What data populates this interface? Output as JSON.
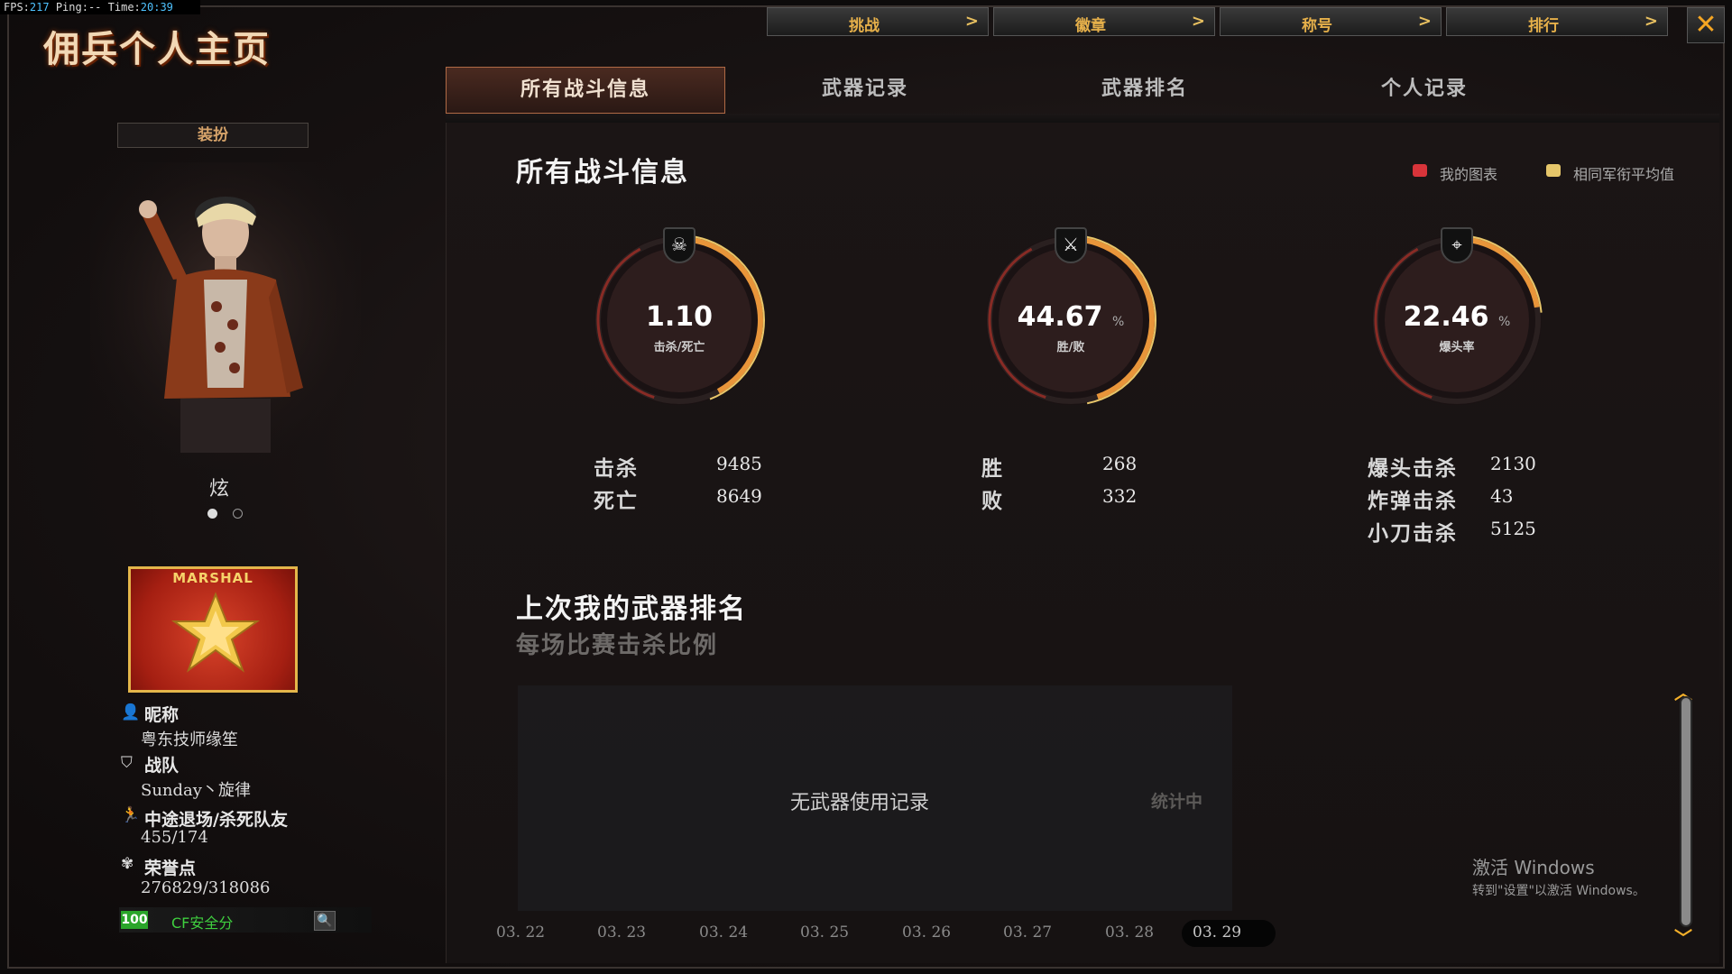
{
  "overlay": {
    "fps_label": "FPS:",
    "fps_value": "217",
    "ping_label": "Ping:",
    "ping_value": "--",
    "time_label": "Time:",
    "time_value": "20:39"
  },
  "window": {
    "title": "佣兵个人主页",
    "close_label": "✕"
  },
  "top_nav": [
    {
      "label": "挑战",
      "chevron": ">"
    },
    {
      "label": "徽章",
      "chevron": ">"
    },
    {
      "label": "称号",
      "chevron": ">"
    },
    {
      "label": "排行",
      "chevron": ">"
    }
  ],
  "tabs": [
    {
      "label": "所有战斗信息",
      "active": true
    },
    {
      "label": "武器记录",
      "active": false
    },
    {
      "label": "武器排名",
      "active": false
    },
    {
      "label": "个人记录",
      "active": false
    }
  ],
  "sidebar": {
    "dress_button": "装扮",
    "avatar_caption": "炫",
    "carousel_active_index": 0,
    "rank": {
      "text": "MARSHAL"
    },
    "info": [
      {
        "icon": "person-icon",
        "label": "昵称",
        "value": "粤东技师缘笙"
      },
      {
        "icon": "shield-icon",
        "label": "战队",
        "value": "Sunday丶旋律"
      },
      {
        "icon": "running-icon",
        "label": "中途退场/杀死队友",
        "value": "455/174"
      },
      {
        "icon": "badge-icon",
        "label": "荣誉点",
        "value": "276829/318086"
      }
    ],
    "safety": {
      "score": "100",
      "label": "CF安全分"
    }
  },
  "main": {
    "section_title": "所有战斗信息",
    "legend": [
      {
        "label": "我的图表",
        "color": "#d8343a"
      },
      {
        "label": "相同军衔平均值",
        "color": "#e6c66a"
      }
    ],
    "gauges": [
      {
        "id": "kd",
        "value": "1.10",
        "unit": "",
        "sublabel": "击杀/死亡",
        "icon": "skull-icon",
        "fill": 0.42
      },
      {
        "id": "winrate",
        "value": "44.67",
        "unit": "%",
        "sublabel": "胜/败",
        "icon": "crossed-swords-icon",
        "fill": 0.4467
      },
      {
        "id": "headshot",
        "value": "22.46",
        "unit": "%",
        "sublabel": "爆头率",
        "icon": "crosshair-icon",
        "fill": 0.2246
      }
    ],
    "stats_kd": [
      {
        "label": "击杀",
        "value": "9485"
      },
      {
        "label": "死亡",
        "value": "8649"
      }
    ],
    "stats_win": [
      {
        "label": "胜",
        "value": "268"
      },
      {
        "label": "败",
        "value": "332"
      }
    ],
    "stats_special": [
      {
        "label": "爆头击杀",
        "value": "2130"
      },
      {
        "label": "炸弹击杀",
        "value": "43"
      },
      {
        "label": "小刀击杀",
        "value": "5125"
      }
    ],
    "weapon_section_title": "上次我的武器排名",
    "weapon_section_subtitle": "每场比赛击杀比例",
    "no_record_text": "无武器使用记录",
    "counting_text": "统计中",
    "dates": [
      "03. 22",
      "03. 23",
      "03. 24",
      "03. 25",
      "03. 26",
      "03. 27",
      "03. 28",
      "03. 29"
    ],
    "selected_date_index": 7
  },
  "watermark": {
    "line1": "激活 Windows",
    "line2": "转到\"设置\"以激活 Windows。"
  },
  "colors": {
    "accent_orange": "#e6b04a",
    "ring_red": "#c8342a",
    "ring_orange": "#e8953a",
    "ring_yellow": "#e8c66a"
  }
}
